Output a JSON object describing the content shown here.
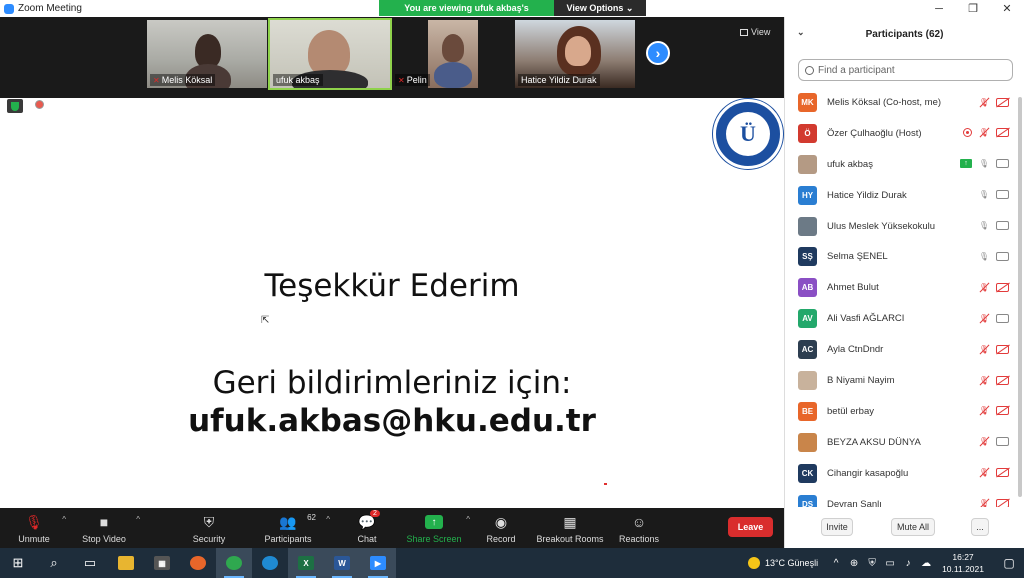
{
  "window": {
    "title": "Zoom Meeting"
  },
  "share_banner": {
    "viewing_text": "You are viewing ufuk akbaş's screen",
    "options_label": "View Options ⌄"
  },
  "video_strip": {
    "tiles": [
      {
        "name": "Melis Köksal",
        "muted": true
      },
      {
        "name": "ufuk akbaş",
        "muted": false
      },
      {
        "name": "Pelin",
        "muted": true
      },
      {
        "name": "Hatice Yildiz Durak",
        "muted": false
      }
    ],
    "view_label": "View"
  },
  "slide": {
    "logo_text": "BARTIN ÜNİVERSİTESİ 2008",
    "thanks": "Teşekkür Ederim",
    "feedback": "Geri bildirimleriniz için:",
    "email": "ufuk.akbas@hku.edu.tr"
  },
  "toolbar": {
    "unmute": "Unmute",
    "stop_video": "Stop Video",
    "security": "Security",
    "participants": "Participants",
    "participants_count": "62",
    "chat": "Chat",
    "chat_badge": "2",
    "share_screen": "Share Screen",
    "record": "Record",
    "breakout_rooms": "Breakout Rooms",
    "reactions": "Reactions",
    "leave": "Leave"
  },
  "panel": {
    "title": "Participants (62)",
    "search_placeholder": "Find a participant",
    "participants": [
      {
        "initials": "MK",
        "color": "#e8662a",
        "name": "Melis Köksal (Co-host, me)",
        "mic": "muted",
        "cam": "off"
      },
      {
        "initials": "Ö",
        "color": "#d23a2f",
        "name": "Özer Çulhaoğlu (Host)",
        "mic": "muted",
        "cam": "off",
        "recording": true
      },
      {
        "initials": "",
        "color": "#b49a84",
        "name": "ufuk akbaş",
        "mic": "on",
        "cam": "on",
        "sharing": true,
        "photo": true
      },
      {
        "initials": "HY",
        "color": "#2a7ed2",
        "name": "Hatice Yildiz Durak",
        "mic": "on",
        "cam": "on"
      },
      {
        "initials": "",
        "color": "#6c7a86",
        "name": "Ulus Meslek Yüksekokulu",
        "mic": "on",
        "cam": "on",
        "photo": true
      },
      {
        "initials": "SŞ",
        "color": "#1f3a5f",
        "name": "Selma ŞENEL",
        "mic": "on",
        "cam": "on"
      },
      {
        "initials": "AB",
        "color": "#8a4fc4",
        "name": "Ahmet Bulut",
        "mic": "muted",
        "cam": "off"
      },
      {
        "initials": "AV",
        "color": "#23a86b",
        "name": "Ali Vasfi AĞLARCI",
        "mic": "muted",
        "cam": "on"
      },
      {
        "initials": "AC",
        "color": "#2d3e50",
        "name": "Ayla CtnDndr",
        "mic": "muted",
        "cam": "off"
      },
      {
        "initials": "",
        "color": "#c8b29c",
        "name": "B Niyami Nayim",
        "mic": "muted",
        "cam": "off",
        "photo": true
      },
      {
        "initials": "BE",
        "color": "#e8662a",
        "name": "betül erbay",
        "mic": "muted",
        "cam": "off"
      },
      {
        "initials": "",
        "color": "#c9854a",
        "name": "BEYZA AKSU DÜNYA",
        "mic": "muted",
        "cam": "on",
        "photo": true
      },
      {
        "initials": "CK",
        "color": "#1f3a5f",
        "name": "Cihangir kasapoğlu",
        "mic": "muted",
        "cam": "off"
      },
      {
        "initials": "DŞ",
        "color": "#2a7ed2",
        "name": "Devran Şanlı",
        "mic": "muted",
        "cam": "off"
      }
    ],
    "invite": "Invite",
    "mute_all": "Mute All",
    "more": "..."
  },
  "taskbar": {
    "weather": "13°C Güneşli",
    "time": "16:27",
    "date": "10.11.2021"
  },
  "colors": {
    "accent": "#2d8cff",
    "green": "#23b14d",
    "leave": "#d92d2d"
  }
}
